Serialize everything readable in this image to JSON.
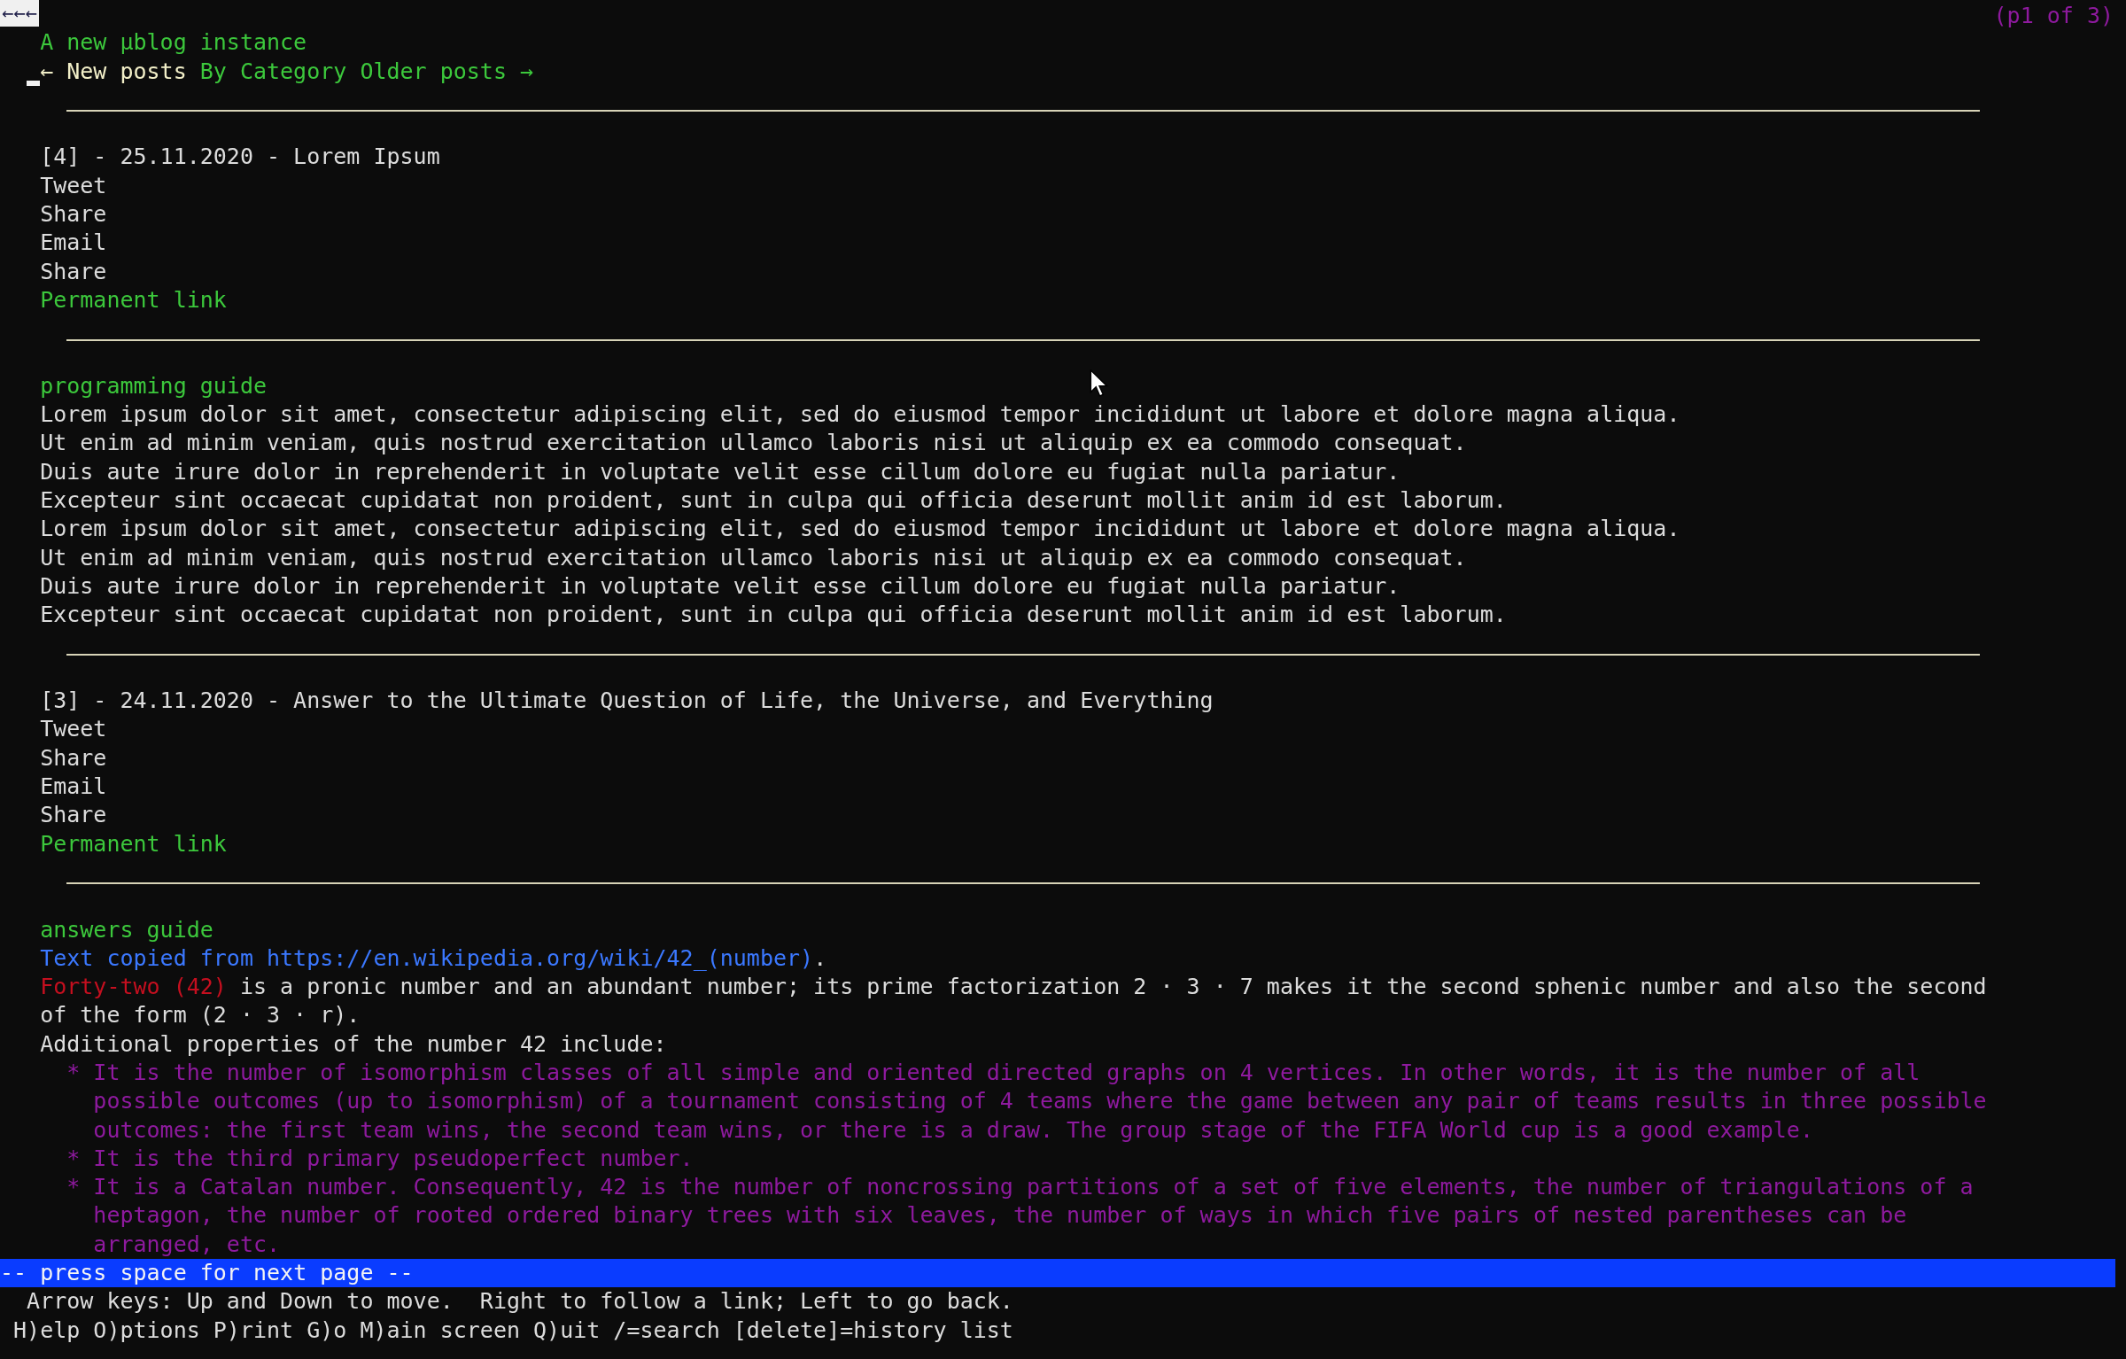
{
  "back_button": "←←←",
  "page_indicator": "(p1 of 3)",
  "site_title": "A new µblog instance",
  "nav": [
    {
      "label": "← New posts",
      "selected": true
    },
    {
      "label": "By Category",
      "selected": false
    },
    {
      "label": "Older posts →",
      "selected": false
    }
  ],
  "posts": [
    {
      "header": "[4] - 25.11.2020 - Lorem Ipsum",
      "share_links": [
        "Tweet",
        "Share",
        "Email",
        "Share"
      ],
      "permalink": "Permanent link",
      "category": "programming guide",
      "body": [
        {
          "kind": "text",
          "lines": [
            [
              {
                "kind": "plain",
                "text": "Lorem ipsum dolor sit amet, consectetur adipiscing elit, sed do eiusmod tempor incididunt ut labore et dolore magna aliqua."
              }
            ],
            [
              {
                "kind": "plain",
                "text": "Ut enim ad minim veniam, quis nostrud exercitation ullamco laboris nisi ut aliquip ex ea commodo consequat."
              }
            ],
            [
              {
                "kind": "plain",
                "text": "Duis aute irure dolor in reprehenderit in voluptate velit esse cillum dolore eu fugiat nulla pariatur."
              }
            ],
            [
              {
                "kind": "plain",
                "text": "Excepteur sint occaecat cupidatat non proident, sunt in culpa qui officia deserunt mollit anim id est laborum."
              }
            ],
            [
              {
                "kind": "plain",
                "text": "Lorem ipsum dolor sit amet, consectetur adipiscing elit, sed do eiusmod tempor incididunt ut labore et dolore magna aliqua."
              }
            ],
            [
              {
                "kind": "plain",
                "text": "Ut enim ad minim veniam, quis nostrud exercitation ullamco laboris nisi ut aliquip ex ea commodo consequat."
              }
            ],
            [
              {
                "kind": "plain",
                "text": "Duis aute irure dolor in reprehenderit in voluptate velit esse cillum dolore eu fugiat nulla pariatur."
              }
            ],
            [
              {
                "kind": "plain",
                "text": "Excepteur sint occaecat cupidatat non proident, sunt in culpa qui officia deserunt mollit anim id est laborum."
              }
            ]
          ]
        }
      ]
    },
    {
      "header": "[3] - 24.11.2020 - Answer to the Ultimate Question of Life, the Universe, and Everything",
      "share_links": [
        "Tweet",
        "Share",
        "Email",
        "Share"
      ],
      "permalink": "Permanent link",
      "category": "answers guide",
      "body": [
        {
          "kind": "text",
          "lines": [
            [
              {
                "kind": "link",
                "text": "Text copied from https://en.wikipedia.org/wiki/42_(number)"
              },
              {
                "kind": "plain",
                "text": "."
              }
            ]
          ]
        },
        {
          "kind": "text",
          "lines": [
            [
              {
                "kind": "emphasis",
                "text": "Forty-two (42)"
              },
              {
                "kind": "plain",
                "text": " is a pronic number and an abundant number; its prime factorization 2 · 3 · 7 makes it the second sphenic number and also the second"
              }
            ],
            [
              {
                "kind": "plain",
                "text": "of the form (2 · 3 · r)."
              }
            ]
          ]
        },
        {
          "kind": "text",
          "lines": [
            [
              {
                "kind": "plain",
                "text": "Additional properties of the number 42 include:"
              }
            ]
          ]
        },
        {
          "kind": "bullet",
          "marker": "*",
          "lines": [
            "It is the number of isomorphism classes of all simple and oriented directed graphs on 4 vertices. In other words, it is the number of all",
            "possible outcomes (up to isomorphism) of a tournament consisting of 4 teams where the game between any pair of teams results in three possible",
            "outcomes: the first team wins, the second team wins, or there is a draw. The group stage of the FIFA World cup is a good example."
          ]
        },
        {
          "kind": "bullet",
          "marker": "*",
          "lines": [
            "It is the third primary pseudoperfect number."
          ]
        },
        {
          "kind": "bullet",
          "marker": "*",
          "lines": [
            "It is a Catalan number. Consequently, 42 is the number of noncrossing partitions of a set of five elements, the number of triangulations of a",
            "heptagon, the number of rooted ordered binary trees with six leaves, the number of ways in which five pairs of nested parentheses can be",
            "arranged, etc."
          ]
        }
      ]
    }
  ],
  "status_line": "-- press space for next page --",
  "help_lines": [
    "Arrow keys: Up and Down to move.  Right to follow a link; Left to go back.",
    "H)elp O)ptions P)rint G)o M)ain screen Q)uit /=search [delete]=history list"
  ]
}
